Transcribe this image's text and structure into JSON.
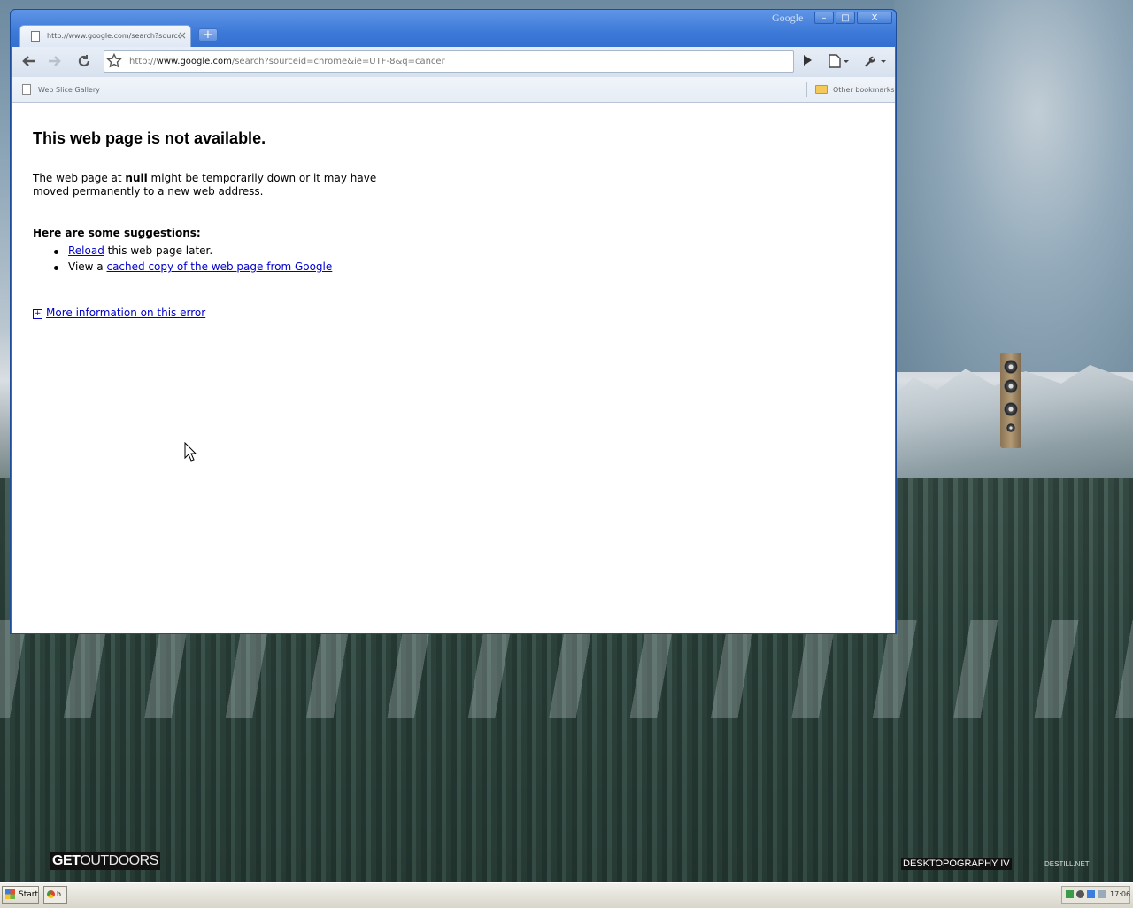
{
  "desktop": {
    "brand_left_bold": "GET",
    "brand_left_thin": "OUTDOORS",
    "brand_right": "DESKTOPOGRAPHY IV",
    "brand_right_small": "DESTILL.NET"
  },
  "window": {
    "brand": "Google",
    "buttons": {
      "minimize": "–",
      "maximize": "□",
      "close": "X"
    }
  },
  "tab": {
    "title": "http://www.google.com/search?sourcei...",
    "close": "×",
    "new_tab": "+"
  },
  "toolbar": {
    "url_prefix": "http://",
    "url_host": "www.google.com",
    "url_rest": "/search?sourceid=chrome&ie=UTF-8&q=cancer"
  },
  "bookmarks": {
    "items": [
      {
        "label": "Web Slice Gallery"
      }
    ],
    "other": "Other bookmarks"
  },
  "page": {
    "title": "This web page is not available.",
    "desc_before": "The web page at ",
    "desc_bold": "null",
    "desc_after": " might be temporarily down or it may have moved permanently to a new web address.",
    "suggestions_heading": "Here are some suggestions:",
    "suggestion1_link": "Reload",
    "suggestion1_rest": " this web page later.",
    "suggestion2_prefix": "View a ",
    "suggestion2_link": "cached copy of the web page from Google",
    "more_info_link": "More information on this error"
  },
  "taskbar": {
    "start_label": "Start",
    "task_label": "h",
    "clock": "17:06"
  },
  "colors": {
    "title_bar": "#3d7ad8",
    "link": "#0000cc"
  }
}
